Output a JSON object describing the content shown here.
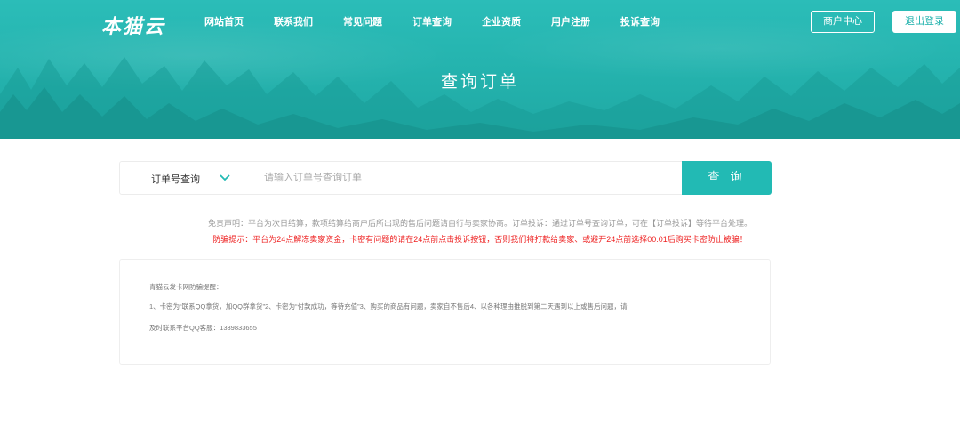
{
  "header": {
    "logo_text": "本猫云",
    "nav": [
      {
        "label": "网站首页"
      },
      {
        "label": "联系我们"
      },
      {
        "label": "常见问题"
      },
      {
        "label": "订单查询"
      },
      {
        "label": "企业资质"
      },
      {
        "label": "用户注册"
      },
      {
        "label": "投诉查询"
      }
    ],
    "merchant_button": "商户中心",
    "logout_button": "退出登录"
  },
  "hero": {
    "title": "查询订单"
  },
  "search": {
    "select_value": "订单号查询",
    "placeholder": "请输入订单号查询订单",
    "value": "",
    "button_label": "查 询"
  },
  "disclaimer": "免责声明：平台为次日结算，款项结算给商户后所出现的售后问题请自行与卖家协商。订单投诉：通过订单号查询订单，可在【订单投诉】等待平台处理。",
  "warning": "防骗提示：平台为24点解冻卖家资金，卡密有问题的请在24点前点击投诉按钮，否则我们将打款给卖家、或避开24点前选择00:01后购买卡密防止被骗！",
  "notice": {
    "line1": "青猫云发卡网防骗提醒：",
    "line2": "1、卡密为“联系QQ拿货，加QQ群拿货”2、卡密为“付款成功，等待充值”3、购买的商品有问题，卖家自不售后4、以各种理由推脱到第二天遇到以上或售后问题，请",
    "line3": "及时联系平台QQ客服：1339833655"
  },
  "colors": {
    "accent": "#22bab4",
    "warning": "#ee2222",
    "muted": "#999999"
  },
  "icons": {
    "dropdown": "chevron-down-icon"
  }
}
